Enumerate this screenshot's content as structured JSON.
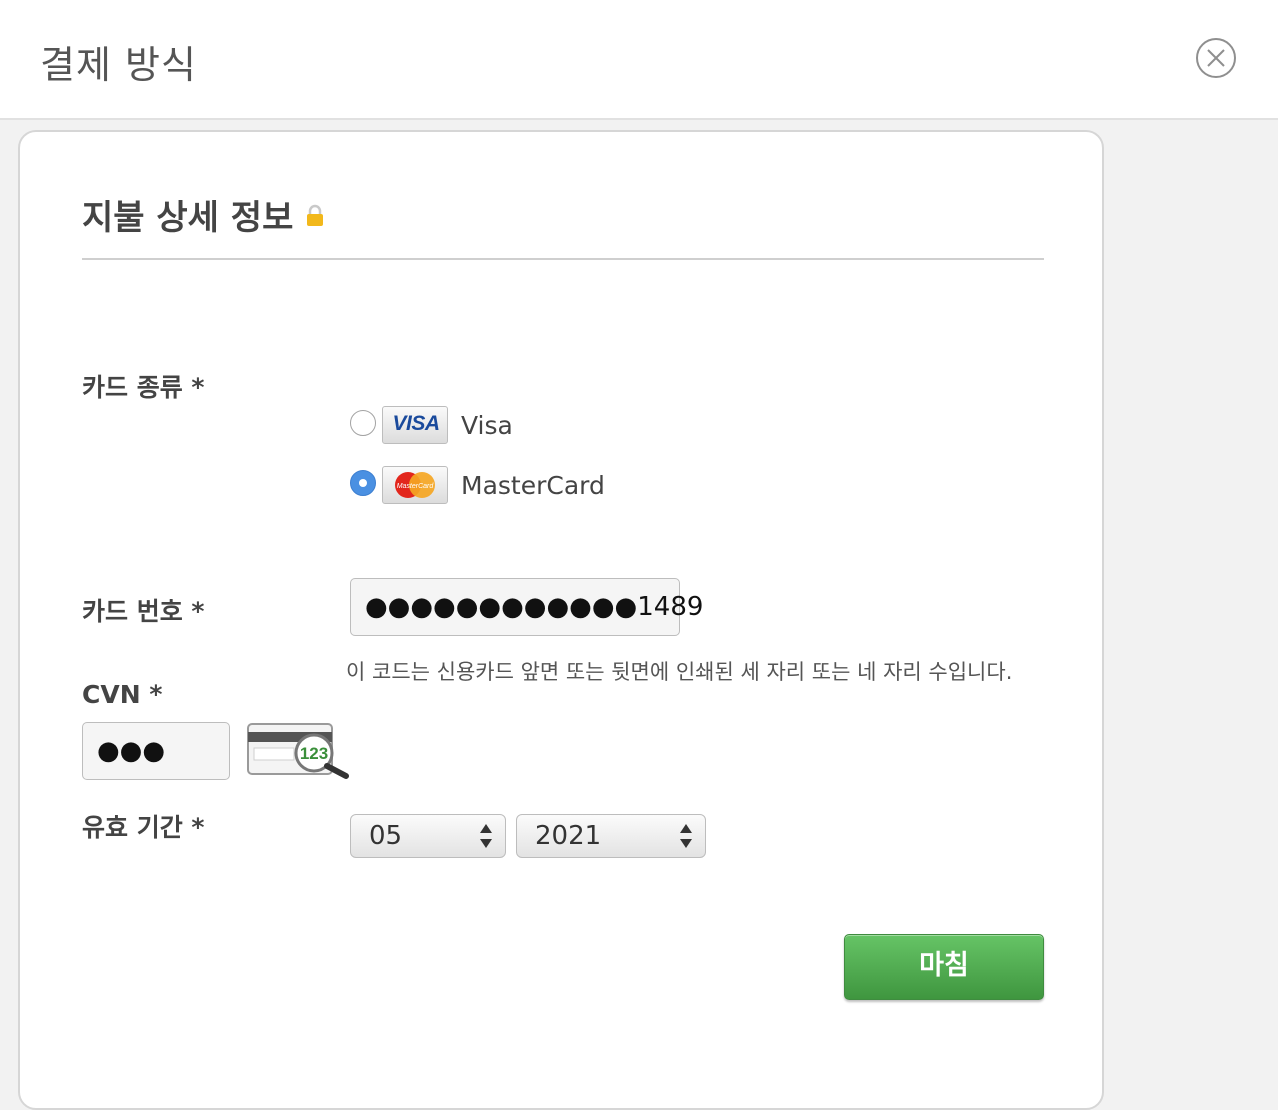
{
  "header": {
    "title": "결제 방식",
    "close_icon": "close-circle-icon"
  },
  "section": {
    "title": "지불 상세 정보",
    "lock_icon": "lock-icon"
  },
  "card_type": {
    "label": "카드 종류 *",
    "options": [
      {
        "label": "Visa",
        "logo_text": "VISA",
        "selected": false
      },
      {
        "label": "MasterCard",
        "logo_text": "MasterCard",
        "selected": true
      }
    ]
  },
  "card_number": {
    "label": "카드 번호 *",
    "value": "●●●●●●●●●●●●1489",
    "hint": "이 코드는 신용카드 앞면 또는 뒷면에 인쇄된 세 자리 또는 네 자리 수입니다."
  },
  "cvn": {
    "label": "CVN *",
    "value": "●●●",
    "helper_image_text": "123"
  },
  "expiry": {
    "label": "유효 기간 *",
    "month": "05",
    "year": "2021"
  },
  "actions": {
    "finish_label": "마침"
  },
  "colors": {
    "accent_blue": "#4a90e2",
    "finish_green": "#52ad52",
    "lock_yellow": "#f2b81b"
  }
}
